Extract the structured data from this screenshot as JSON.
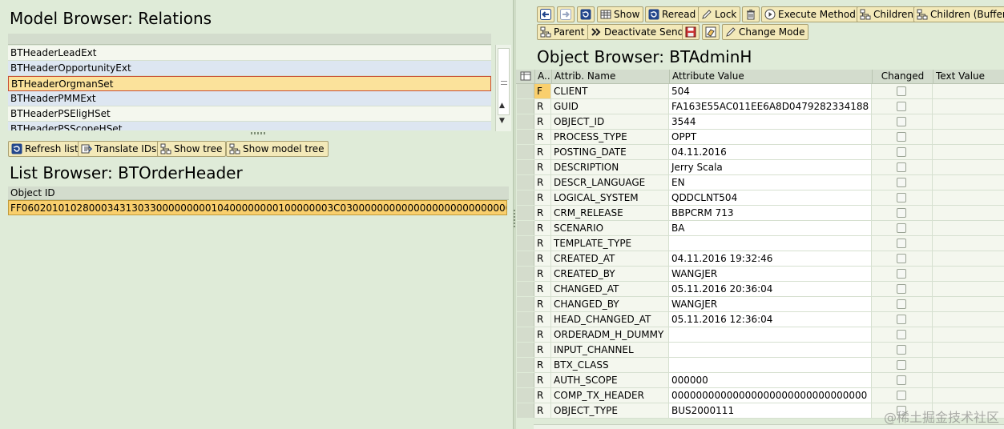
{
  "model_browser": {
    "title": "Model Browser: Relations",
    "items": [
      {
        "label": "BTHeaderLeadExt",
        "state": "even"
      },
      {
        "label": "BTHeaderOpportunityExt",
        "state": "odd"
      },
      {
        "label": "BTHeaderOrgmanSet",
        "state": "sel"
      },
      {
        "label": "BTHeaderPMMExt",
        "state": "odd"
      },
      {
        "label": "BTHeaderPSEligHSet",
        "state": "even"
      },
      {
        "label": "BTHeaderPSScopeHSet",
        "state": "odd"
      }
    ],
    "toolbar": {
      "refresh_list": "Refresh list",
      "translate_ids": "Translate IDs",
      "show_tree": "Show tree",
      "show_model_tree": "Show model tree"
    }
  },
  "list_browser": {
    "title": "List Browser: BTOrderHeader",
    "column_header": "Object ID",
    "object_id": "FF060201010280003431303300000000010400000000100000003C030000000000000000000000000000..."
  },
  "object_browser": {
    "title": "Object Browser: BTAdminH",
    "toolbar": {
      "show": "Show",
      "reread": "Reread",
      "lock": "Lock",
      "execute_method": "Execute Method",
      "children": "Children",
      "children_buffer": "Children (Buffer)",
      "parent": "Parent",
      "deactivate_send": "Deactivate Send",
      "change_mode": "Change Mode"
    },
    "columns": {
      "a": "A..",
      "attrib_name": "Attrib. Name",
      "attribute_value": "Attribute Value",
      "changed": "Changed",
      "text_value": "Text Value"
    },
    "rows": [
      {
        "a": "F",
        "name": "CLIENT",
        "value": "504"
      },
      {
        "a": "R",
        "name": "GUID",
        "value": "FA163E55AC011EE6A8D0479282334188"
      },
      {
        "a": "R",
        "name": "OBJECT_ID",
        "value": "3544"
      },
      {
        "a": "R",
        "name": "PROCESS_TYPE",
        "value": "OPPT"
      },
      {
        "a": "R",
        "name": "POSTING_DATE",
        "value": "04.11.2016"
      },
      {
        "a": "R",
        "name": "DESCRIPTION",
        "value": "Jerry Scala"
      },
      {
        "a": "R",
        "name": "DESCR_LANGUAGE",
        "value": "EN"
      },
      {
        "a": "R",
        "name": "LOGICAL_SYSTEM",
        "value": "QDDCLNT504"
      },
      {
        "a": "R",
        "name": "CRM_RELEASE",
        "value": "BBPCRM 713"
      },
      {
        "a": "R",
        "name": "SCENARIO",
        "value": "BA"
      },
      {
        "a": "R",
        "name": "TEMPLATE_TYPE",
        "value": ""
      },
      {
        "a": "R",
        "name": "CREATED_AT",
        "value": "04.11.2016 19:32:46"
      },
      {
        "a": "R",
        "name": "CREATED_BY",
        "value": "WANGJER"
      },
      {
        "a": "R",
        "name": "CHANGED_AT",
        "value": "05.11.2016 20:36:04"
      },
      {
        "a": "R",
        "name": "CHANGED_BY",
        "value": "WANGJER"
      },
      {
        "a": "R",
        "name": "HEAD_CHANGED_AT",
        "value": "05.11.2016 12:36:04"
      },
      {
        "a": "R",
        "name": "ORDERADM_H_DUMMY",
        "value": ""
      },
      {
        "a": "R",
        "name": "INPUT_CHANNEL",
        "value": ""
      },
      {
        "a": "R",
        "name": "BTX_CLASS",
        "value": ""
      },
      {
        "a": "R",
        "name": "AUTH_SCOPE",
        "value": "000000"
      },
      {
        "a": "R",
        "name": "COMP_TX_HEADER",
        "value": "00000000000000000000000000000000"
      },
      {
        "a": "R",
        "name": "OBJECT_TYPE",
        "value": "BUS2000111"
      }
    ]
  },
  "watermark": "@稀土掘金技术社区",
  "colors": {
    "background": "#dfebd8",
    "selected_row": "#fbe29b",
    "button": "#f3e9b9",
    "selection_border": "#c84c34"
  }
}
